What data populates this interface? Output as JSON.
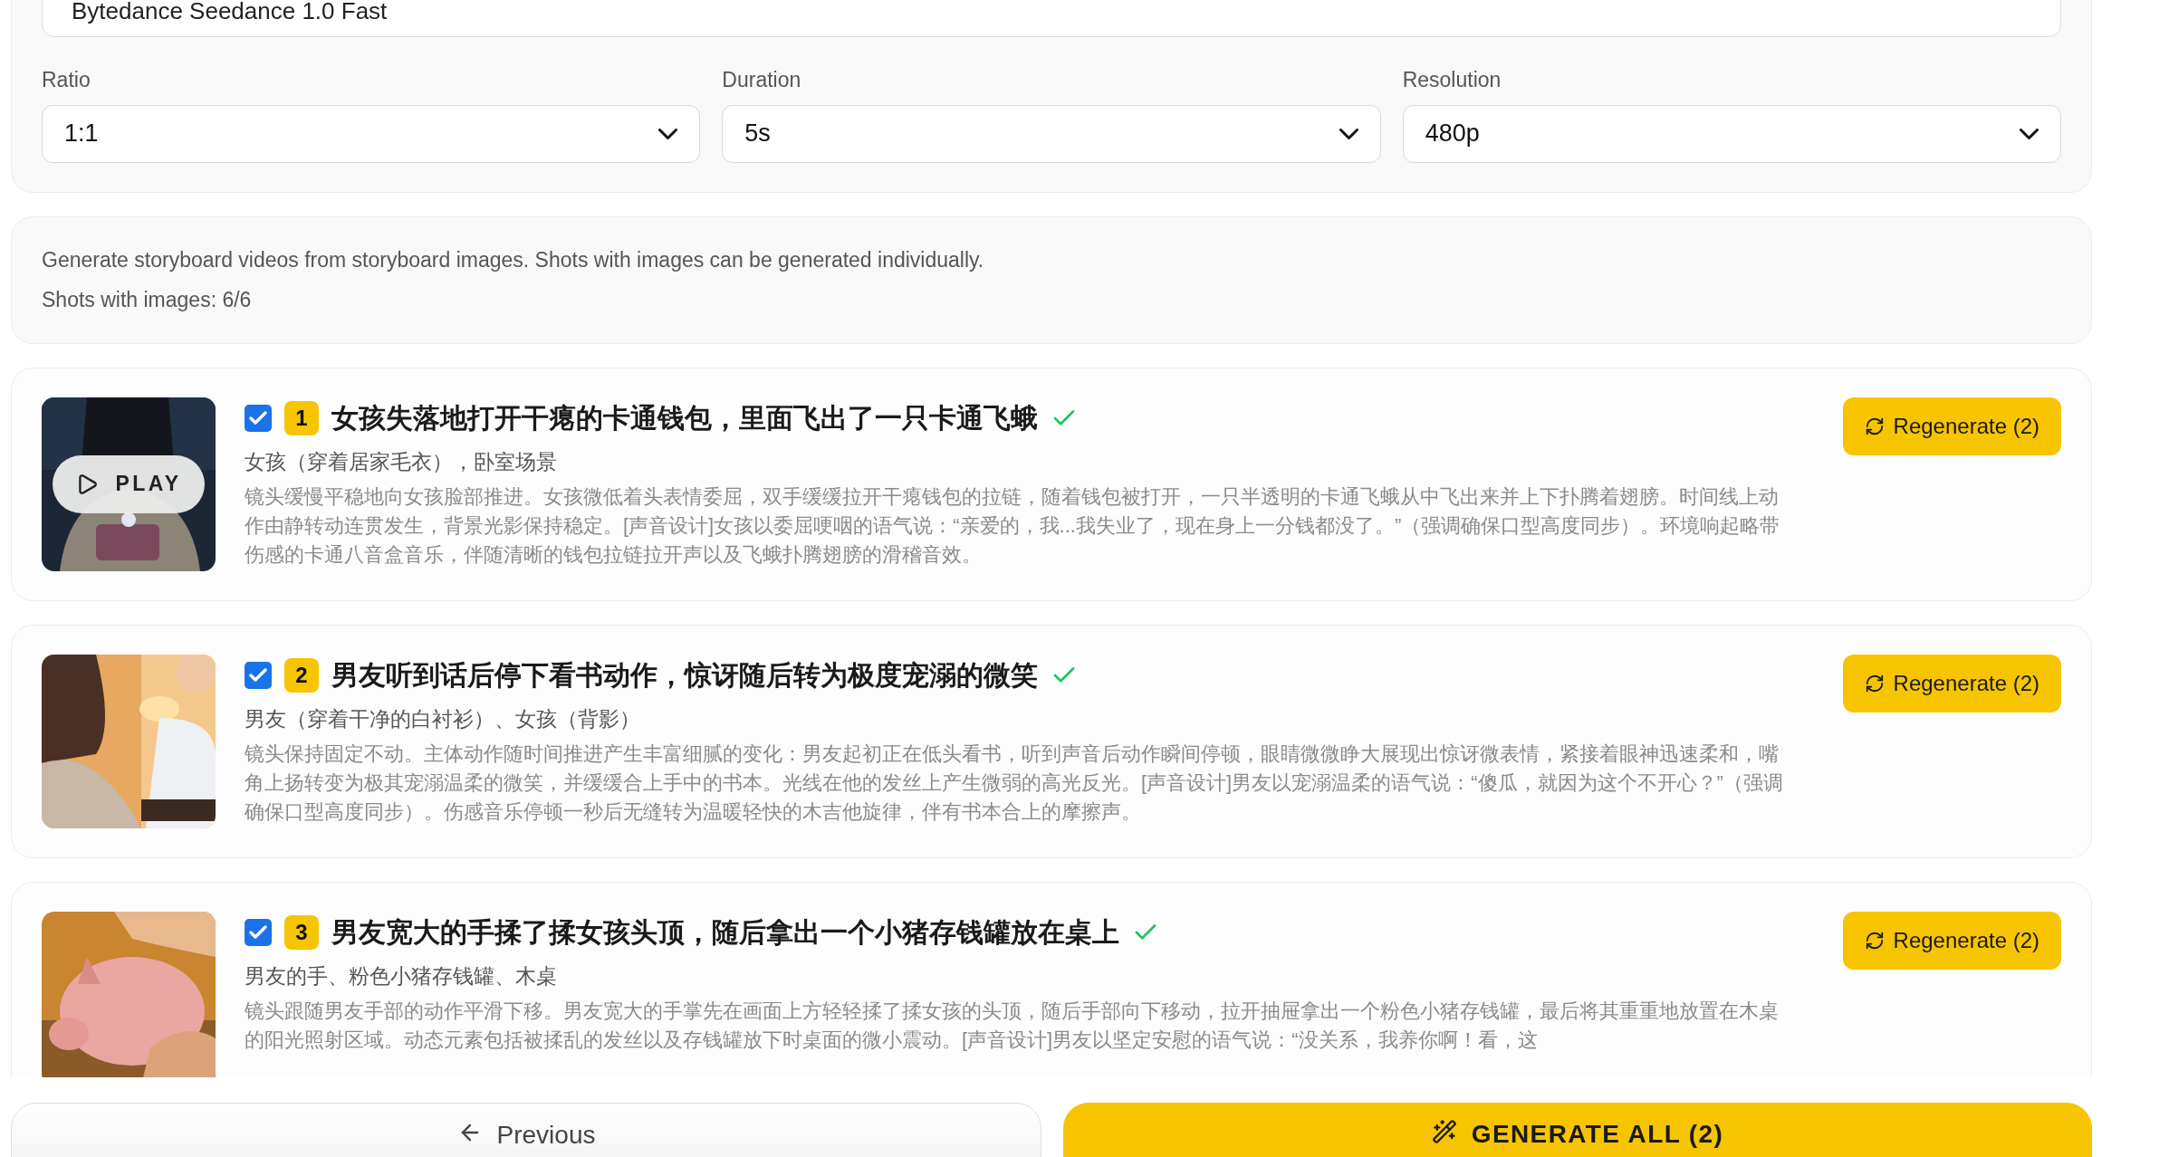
{
  "model_field": {
    "value": "Bytedance Seedance 1.0 Fast"
  },
  "selects": [
    {
      "label": "Ratio",
      "value": "1:1"
    },
    {
      "label": "Duration",
      "value": "5s"
    },
    {
      "label": "Resolution",
      "value": "480p"
    }
  ],
  "info": {
    "description": "Generate storyboard videos from storyboard images. Shots with images can be generated individually.",
    "count": "Shots with images: 6/6"
  },
  "shots": [
    {
      "number": "1",
      "checked": true,
      "done": true,
      "title": "女孩失落地打开干瘪的卡通钱包，里面飞出了一只卡通飞蛾",
      "subtitle": "女孩（穿着居家毛衣），卧室场景",
      "description": "镜头缓慢平稳地向女孩脸部推进。女孩微低着头表情委屈，双手缓缓拉开干瘪钱包的拉链，随着钱包被打开，一只半透明的卡通飞蛾从中飞出来并上下扑腾着翅膀。时间线上动作由静转动连贯发生，背景光影保持稳定。[声音设计]女孩以委屈哽咽的语气说：“亲爱的，我...我失业了，现在身上一分钱都没了。”（强调确保口型高度同步）。环境响起略带伤感的卡通八音盒音乐，伴随清晰的钱包拉链拉开声以及飞蛾扑腾翅膀的滑稽音效。",
      "button": "Regenerate (2)",
      "play_label": "PLAY"
    },
    {
      "number": "2",
      "checked": true,
      "done": true,
      "title": "男友听到话后停下看书动作，惊讶随后转为极度宠溺的微笑",
      "subtitle": "男友（穿着干净的白衬衫）、女孩（背影）",
      "description": "镜头保持固定不动。主体动作随时间推进产生丰富细腻的变化：男友起初正在低头看书，听到声音后动作瞬间停顿，眼睛微微睁大展现出惊讶微表情，紧接着眼神迅速柔和，嘴角上扬转变为极其宠溺温柔的微笑，并缓缓合上手中的书本。光线在他的发丝上产生微弱的高光反光。[声音设计]男友以宠溺温柔的语气说：“傻瓜，就因为这个不开心？”（强调确保口型高度同步）。伤感音乐停顿一秒后无缝转为温暖轻快的木吉他旋律，伴有书本合上的摩擦声。",
      "button": "Regenerate (2)"
    },
    {
      "number": "3",
      "checked": true,
      "done": true,
      "title": "男友宽大的手揉了揉女孩头顶，随后拿出一个小猪存钱罐放在桌上",
      "subtitle": "男友的手、粉色小猪存钱罐、木桌",
      "description": "镜头跟随男友手部的动作平滑下移。男友宽大的手掌先在画面上方轻轻揉了揉女孩的头顶，随后手部向下移动，拉开抽屉拿出一个粉色小猪存钱罐，最后将其重重地放置在木桌的阳光照射区域。动态元素包括被揉乱的发丝以及存钱罐放下时桌面的微小震动。[声音设计]男友以坚定安慰的语气说：“没关系，我养你啊！看，这",
      "button": "Regenerate (2)"
    }
  ],
  "footer": {
    "previous": "Previous",
    "generate": "GENERATE ALL (2)"
  }
}
